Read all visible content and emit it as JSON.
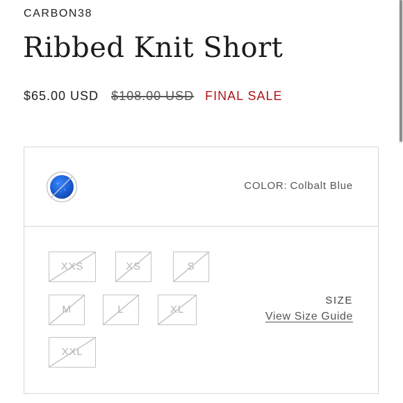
{
  "product": {
    "brand": "CARBON38",
    "name": "Ribbed Knit Short",
    "price": "$65.00 USD",
    "compare_at_price": "$108.00 USD",
    "sale_label": "FINAL SALE"
  },
  "color": {
    "label": "COLOR:",
    "value": "Colbalt Blue",
    "swatch_color": "#1c5fd6",
    "swatch_available": false
  },
  "size": {
    "label": "SIZE",
    "guide_link": "View Size Guide",
    "options": [
      {
        "label": "XXS",
        "available": false
      },
      {
        "label": "XS",
        "available": false
      },
      {
        "label": "S",
        "available": false
      },
      {
        "label": "M",
        "available": false
      },
      {
        "label": "L",
        "available": false
      },
      {
        "label": "XL",
        "available": false
      },
      {
        "label": "XXL",
        "available": false
      }
    ]
  },
  "colors": {
    "sale_red": "#b0141b",
    "text_dark": "#1f1f1f",
    "border": "#d6d6d6",
    "unavailable": "#b4b4b4"
  }
}
